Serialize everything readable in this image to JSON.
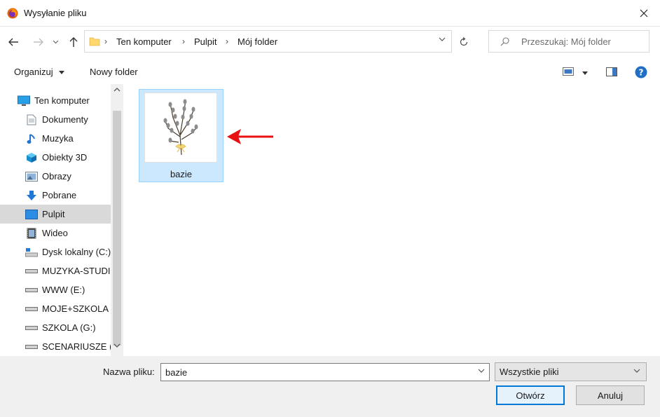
{
  "window": {
    "title": "Wysyłanie pliku"
  },
  "breadcrumb": [
    "Ten komputer",
    "Pulpit",
    "Mój folder"
  ],
  "search": {
    "placeholder": "Przeszukaj: Mój folder"
  },
  "toolbar": {
    "organize_label": "Organizuj",
    "new_folder_label": "Nowy folder"
  },
  "sidebar": {
    "items": [
      {
        "label": "Ten komputer",
        "icon": "computer-icon"
      },
      {
        "label": "Dokumenty",
        "icon": "documents-icon"
      },
      {
        "label": "Muzyka",
        "icon": "music-icon"
      },
      {
        "label": "Obiekty 3D",
        "icon": "3d-objects-icon"
      },
      {
        "label": "Obrazy",
        "icon": "pictures-icon"
      },
      {
        "label": "Pobrane",
        "icon": "downloads-icon"
      },
      {
        "label": "Pulpit",
        "icon": "desktop-icon",
        "selected": true
      },
      {
        "label": "Wideo",
        "icon": "video-icon"
      },
      {
        "label": "Dysk lokalny (C:)",
        "icon": "local-disk-icon"
      },
      {
        "label": "MUZYKA-STUDIO",
        "icon": "drive-icon"
      },
      {
        "label": "WWW (E:)",
        "icon": "drive-icon"
      },
      {
        "label": "MOJE+SZKOLA (",
        "icon": "drive-icon"
      },
      {
        "label": "SZKOLA (G:)",
        "icon": "drive-icon"
      },
      {
        "label": "SCENARIUSZE (H",
        "icon": "drive-icon"
      }
    ]
  },
  "files": [
    {
      "name": "bazie",
      "selected": true
    }
  ],
  "footer": {
    "filename_label": "Nazwa pliku:",
    "filename_value": "bazie",
    "filetype_value": "Wszystkie pliki",
    "open_label": "Otwórz",
    "cancel_label": "Anuluj"
  },
  "colors": {
    "accent": "#0078d7",
    "selection": "#cce8ff",
    "arrow": "#e81010"
  }
}
